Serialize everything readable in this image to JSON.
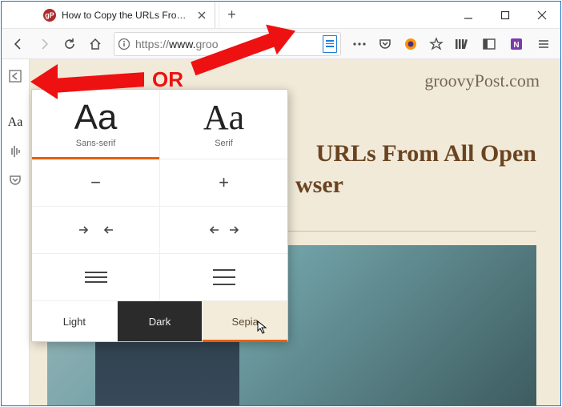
{
  "tab": {
    "favicon_text": "gP",
    "title": "How to Copy the URLs From Al"
  },
  "urlbar": {
    "scheme": "https://",
    "host": "www.",
    "rest": "groo"
  },
  "annotation": {
    "or": "OR"
  },
  "content": {
    "brand": "groovyPost",
    "brand_suffix": ".com",
    "headline_visible_fragment1": "URLs From All Open",
    "headline_visible_fragment2": "wser"
  },
  "reader_popup": {
    "fonts": {
      "sans_sample": "Aa",
      "sans_label": "Sans-serif",
      "serif_sample": "Aa",
      "serif_label": "Serif",
      "selected": "sans"
    },
    "size": {
      "decrease": "−",
      "increase": "+"
    },
    "themes": {
      "light": "Light",
      "dark": "Dark",
      "sepia": "Sepia",
      "selected": "sepia"
    }
  }
}
